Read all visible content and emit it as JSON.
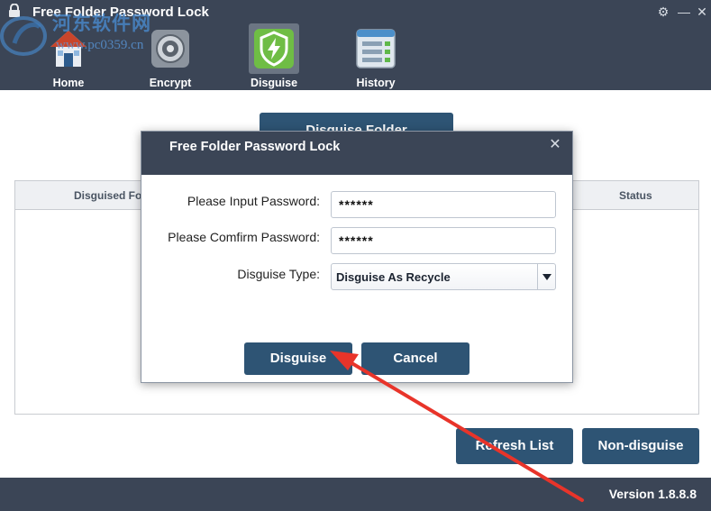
{
  "window": {
    "title": "Free Folder Password Lock"
  },
  "watermark": {
    "text": "河东软件网",
    "url": "www.pc0359.cn"
  },
  "nav": {
    "items": [
      {
        "label": "Home",
        "icon": "house-icon"
      },
      {
        "label": "Encrypt",
        "icon": "safe-lock-icon"
      },
      {
        "label": "Disguise",
        "icon": "shield-bolt-icon",
        "active": true
      },
      {
        "label": "History",
        "icon": "list-history-icon"
      }
    ]
  },
  "main": {
    "disguise_folder_button": "Disguise Folder",
    "list": {
      "col_disguised_folder": "Disguised Fo",
      "col_status": "Status"
    },
    "refresh_button": "Refresh List",
    "nondisguise_button": "Non-disguise"
  },
  "footer": {
    "version": "Version 1.8.8.8"
  },
  "dialog": {
    "title": "Free Folder Password Lock",
    "password_label": "Please Input Password:",
    "password_value": "******",
    "confirm_label": "Please Comfirm Password:",
    "confirm_value": "******",
    "type_label": "Disguise Type:",
    "type_value": "Disguise As Recycle",
    "disguise_button": "Disguise",
    "cancel_button": "Cancel"
  },
  "colors": {
    "header_bg": "#3b4556",
    "button_bg": "#2e5474",
    "annotation_arrow": "#e8342a"
  }
}
